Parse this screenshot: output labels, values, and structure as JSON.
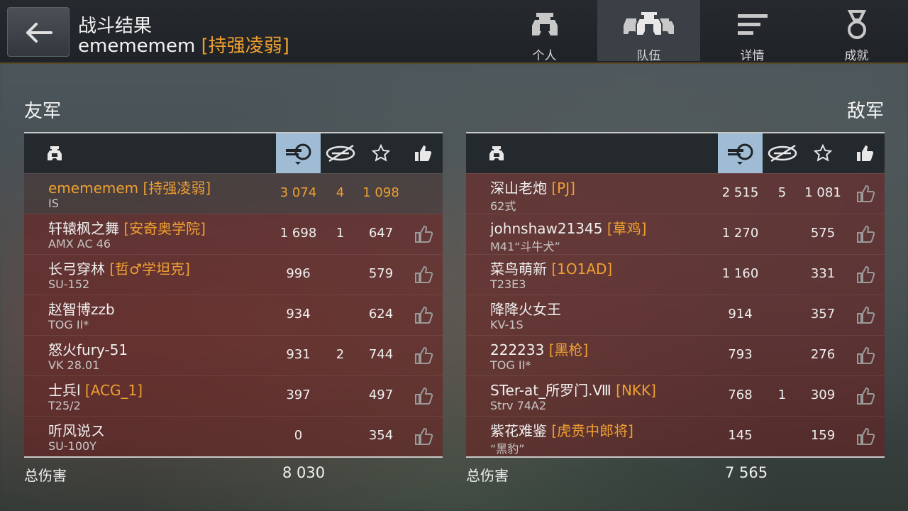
{
  "header": {
    "title": "战斗结果",
    "player": "emememem",
    "clan": "[持强凌弱]",
    "tabs": [
      {
        "label": "个人",
        "icon": "soldier-icon",
        "active": false
      },
      {
        "label": "队伍",
        "icon": "team-icon",
        "active": true
      },
      {
        "label": "详情",
        "icon": "list-icon",
        "active": false
      },
      {
        "label": "成就",
        "icon": "medal-icon",
        "active": false
      }
    ]
  },
  "allies": {
    "title": "友军",
    "rows": [
      {
        "name": "emememem",
        "clan": "[持强凌弱]",
        "tank": "IS",
        "damage": "3 074",
        "kills": "4",
        "score": "1 098",
        "self": true
      },
      {
        "name": "轩辕枫之舞",
        "clan": "[安奇奥学院]",
        "tank": "AMX AC 46",
        "damage": "1 698",
        "kills": "1",
        "score": "647"
      },
      {
        "name": "长弓穿林",
        "clan": "[哲♂学坦克]",
        "tank": "SU-152",
        "damage": "996",
        "kills": "",
        "score": "579"
      },
      {
        "name": "赵智博zzb",
        "clan": "",
        "tank": "TOG II*",
        "damage": "934",
        "kills": "",
        "score": "624"
      },
      {
        "name": "怒火fury-51",
        "clan": "",
        "tank": "VK 28.01",
        "damage": "931",
        "kills": "2",
        "score": "744"
      },
      {
        "name": "士兵l",
        "clan": "[ACG_1]",
        "tank": "T25/2",
        "damage": "397",
        "kills": "",
        "score": "497"
      },
      {
        "name": "听风说ス",
        "clan": "",
        "tank": "SU-100Y",
        "damage": "0",
        "kills": "",
        "score": "354"
      }
    ],
    "total_label": "总伤害",
    "total": "8 030"
  },
  "enemies": {
    "title": "敌军",
    "rows": [
      {
        "name": "深山老炮",
        "clan": "[PJ]",
        "tank": "62式",
        "damage": "2 515",
        "kills": "5",
        "score": "1 081"
      },
      {
        "name": "johnshaw21345",
        "clan": "[草鸡]",
        "tank": "M41“斗牛犬”",
        "damage": "1 270",
        "kills": "",
        "score": "575"
      },
      {
        "name": "菜鸟萌新",
        "clan": "[1O1AD]",
        "tank": "T23E3",
        "damage": "1 160",
        "kills": "",
        "score": "331"
      },
      {
        "name": "降降火女王",
        "clan": "",
        "tank": "KV-1S",
        "damage": "914",
        "kills": "",
        "score": "357"
      },
      {
        "name": "222233",
        "clan": "[黑枪]",
        "tank": "TOG II*",
        "damage": "793",
        "kills": "",
        "score": "276"
      },
      {
        "name": "STer-at_所罗门.Ⅷ",
        "clan": "[NKK]",
        "tank": "Strv 74A2",
        "damage": "768",
        "kills": "1",
        "score": "309"
      },
      {
        "name": "紫花难鉴",
        "clan": "[虎贲中郎将]",
        "tank": "“黑豹”",
        "damage": "145",
        "kills": "",
        "score": "159"
      }
    ],
    "total_label": "总伤害",
    "total": "7 565"
  },
  "colors": {
    "accent": "#f0a030",
    "sorted_column": "#9fbcd4",
    "row": "#6e1e1e"
  }
}
